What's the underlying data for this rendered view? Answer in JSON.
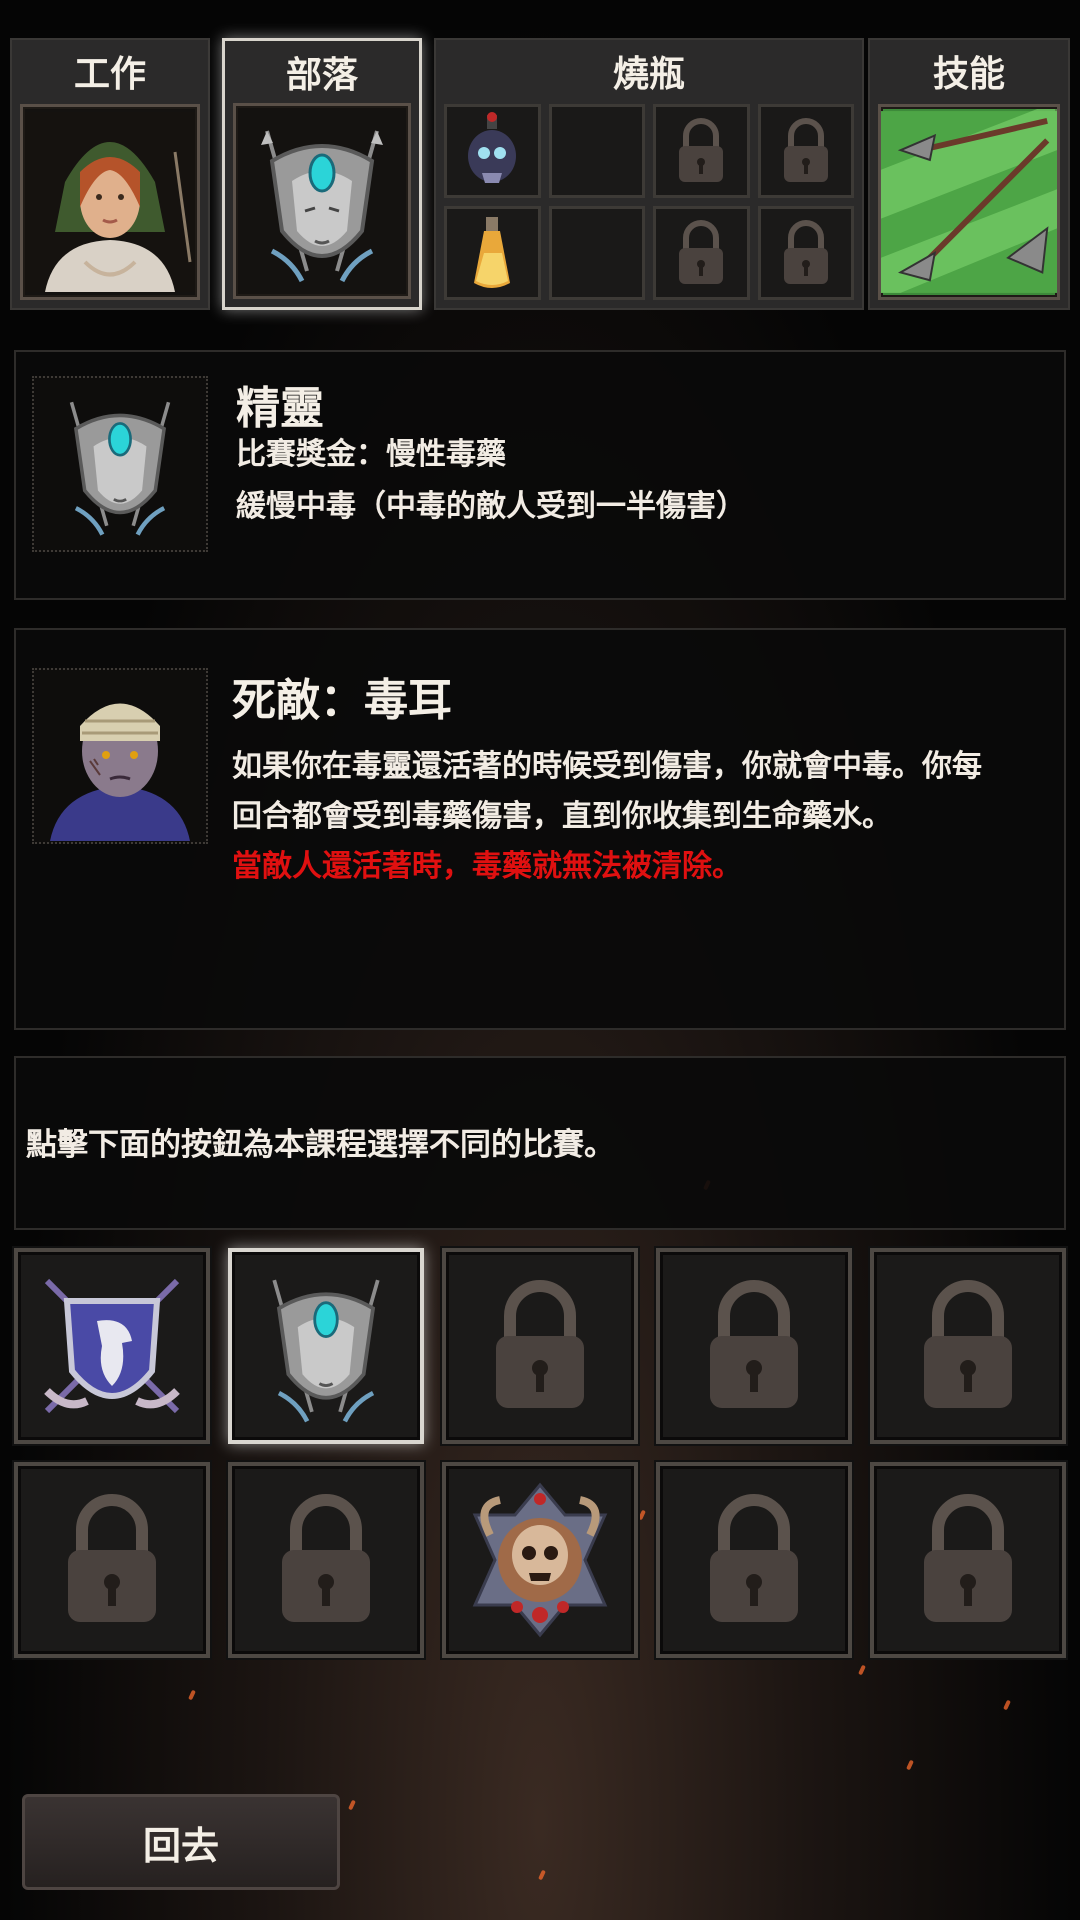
{
  "tabs": {
    "job": "工作",
    "tribe": "部落",
    "flasks": "燒瓶",
    "skills": "技能"
  },
  "tribe_info": {
    "name": "精靈",
    "bonus": "比賽獎金：慢性毒藥",
    "effect": "緩慢中毒（中毒的敵人受到一半傷害）"
  },
  "nemesis": {
    "title": "死敵：毒耳",
    "line1": "如果你在毒靈還活著的時候受到傷害，你就會中毒。你每",
    "line2": "回合都會受到毒藥傷害，直到你收集到生命藥水。",
    "warning": "當敵人還活著時，毒藥就無法被清除。"
  },
  "hint": "點擊下面的按鈕為本課程選擇不同的比賽。",
  "tribe_tiles": [
    {
      "icon": "eagle-shield-icon",
      "selected": false
    },
    {
      "icon": "elf-mask-icon",
      "selected": true
    },
    {
      "icon": "lock-icon",
      "selected": false
    },
    {
      "icon": "lock-icon",
      "selected": false
    },
    {
      "icon": "lock-icon",
      "selected": false
    },
    {
      "icon": "lock-icon",
      "selected": false
    },
    {
      "icon": "lock-icon",
      "selected": false
    },
    {
      "icon": "skull-emblem-icon",
      "selected": false
    },
    {
      "icon": "lock-icon",
      "selected": false
    },
    {
      "icon": "lock-icon",
      "selected": false
    }
  ],
  "back_label": "回去",
  "colors": {
    "warning": "#e01010",
    "background": "#050505",
    "accent_teal": "#2bd4d8"
  }
}
